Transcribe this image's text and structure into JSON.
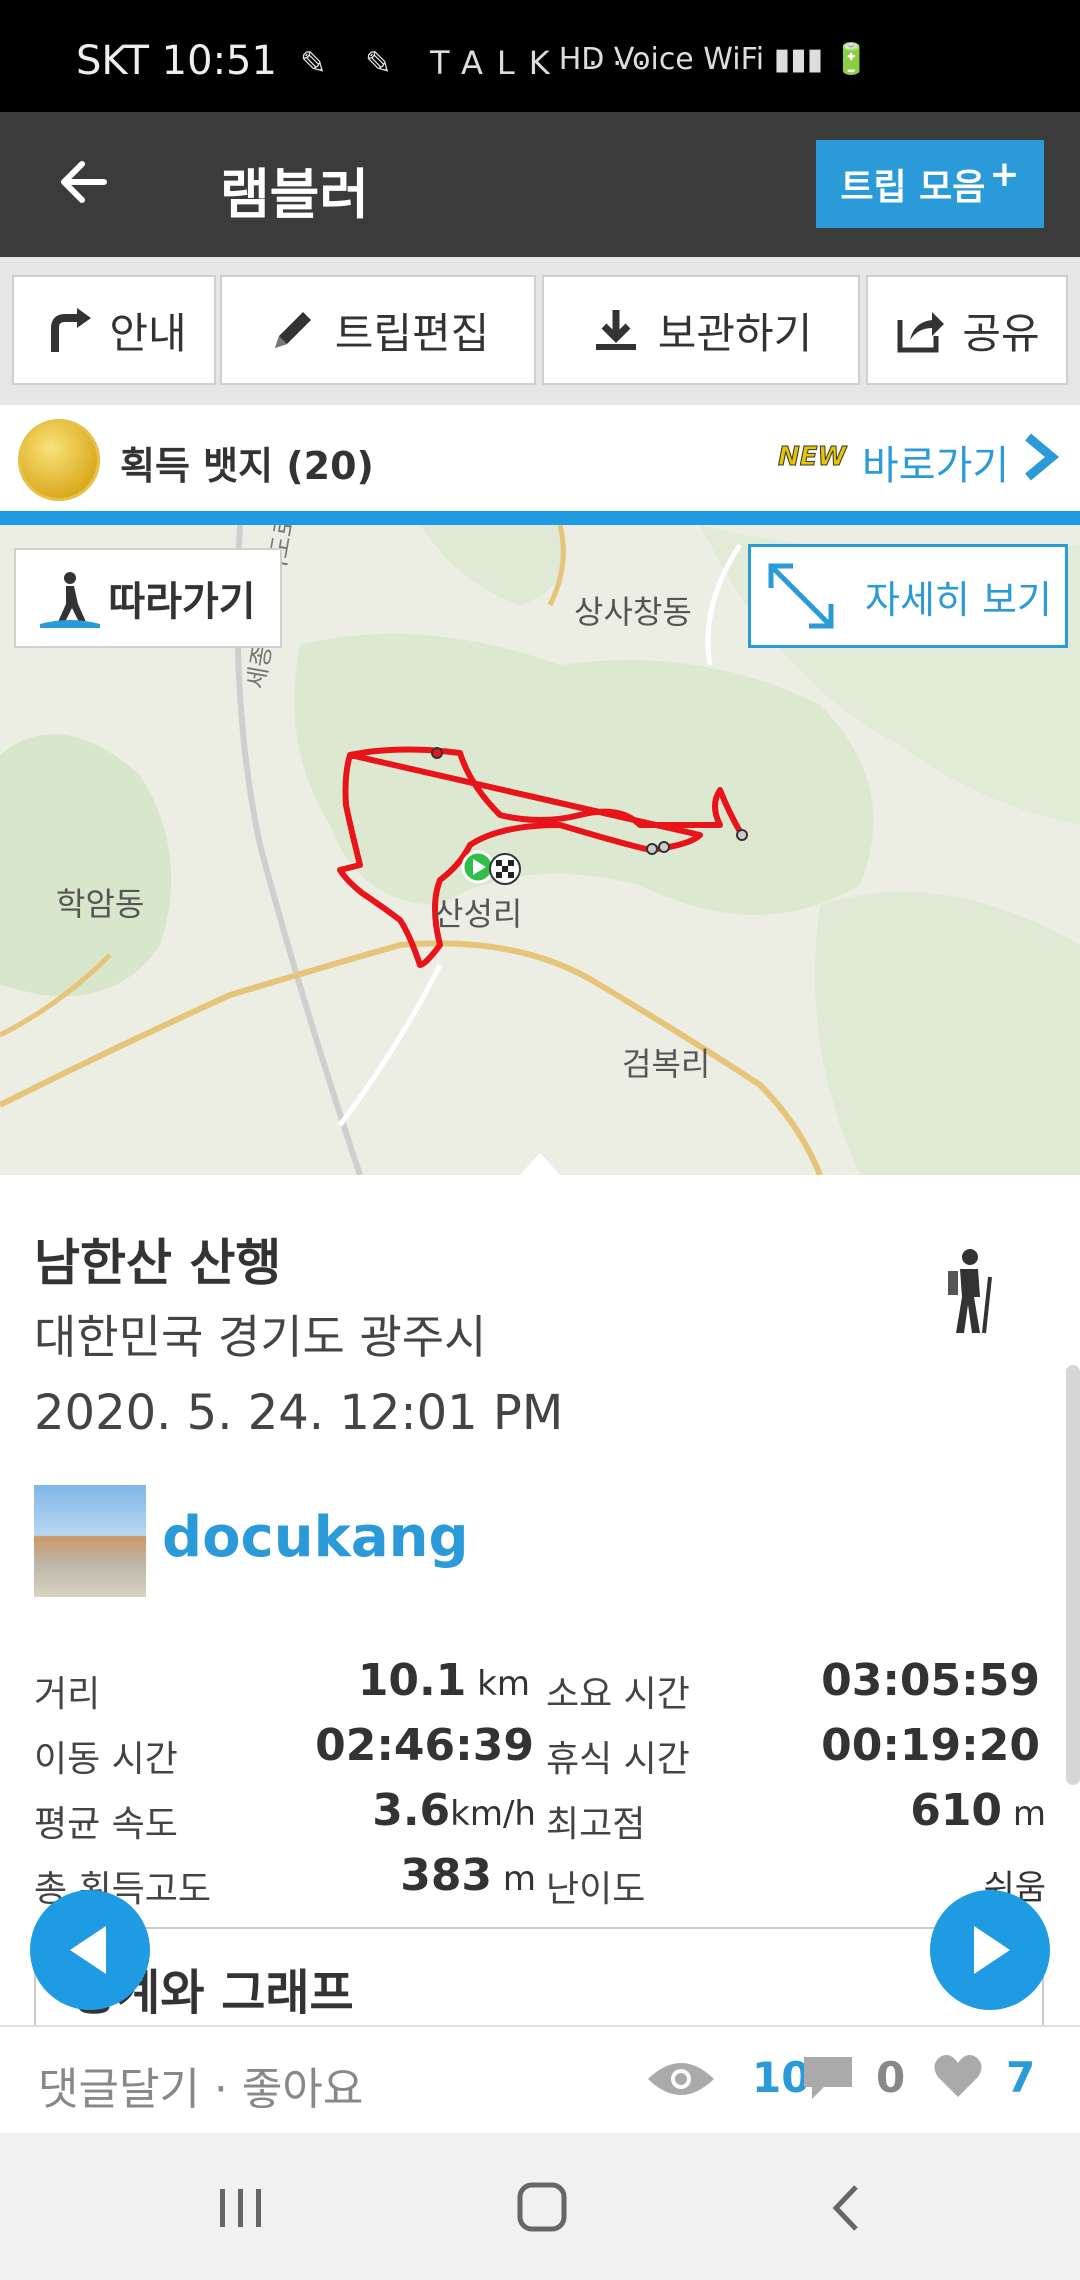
{
  "status_bar": {
    "carrier_time": "SKT 10:51",
    "notif_icons": "✎ ✎ TALK ···",
    "right_icons": "HD Voice  WiFi  ▮▮▮ 🔋"
  },
  "app_bar": {
    "title": "램블러",
    "trip_button": "트립 모음",
    "trip_plus": "+"
  },
  "toolbar": {
    "guide": "안내",
    "edit": "트립편집",
    "save": "보관하기",
    "share": "공유"
  },
  "badge": {
    "text": "획득 뱃지 (20)",
    "new_tag": "NEW",
    "link": "바로가기"
  },
  "map": {
    "follow_button": "따라가기",
    "detail_button": "자세히 보기",
    "labels": {
      "sangsa": "상사창동",
      "hakam": "학암동",
      "sanseong": "산성리",
      "geombok": "검복리",
      "road": "세종포천고속도로"
    },
    "route_color": "#e8141a"
  },
  "trip": {
    "name": "남한산 산행",
    "location": "대한민국 경기도 광주시",
    "datetime": "2020. 5. 24. 12:01 PM",
    "user": "docukang"
  },
  "stats": [
    {
      "label": "거리",
      "value": "10.1",
      "unit": " km",
      "label2": "소요 시간",
      "value2": "03:05:59",
      "unit2": ""
    },
    {
      "label": "이동 시간",
      "value": "02:46:39",
      "unit": "",
      "label2": "휴식 시간",
      "value2": "00:19:20",
      "unit2": ""
    },
    {
      "label": "평균 속도",
      "value": "3.6",
      "unit": "km/h",
      "label2": "최고점",
      "value2": "610",
      "unit2": " m"
    },
    {
      "label": "총 획득고도",
      "value": "383",
      "unit": " m",
      "label2": "난이도",
      "value2": "쉬움",
      "unit2": ""
    }
  ],
  "section_title": "통계와 그래프",
  "comment_bar": {
    "comment_like": "댓글달기 · 좋아요",
    "views": "10",
    "comments": "0",
    "likes": "7"
  },
  "colors": {
    "accent": "#2a9ad8",
    "appbar": "#3b3b3b",
    "route": "#e8141a"
  }
}
